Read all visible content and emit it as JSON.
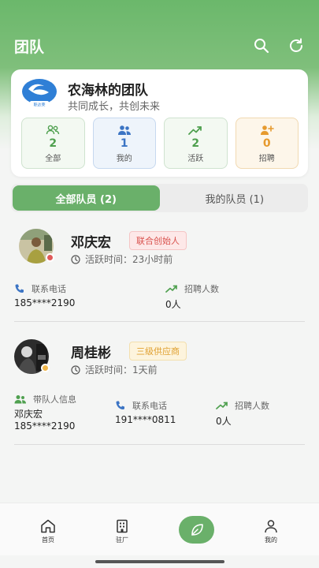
{
  "header": {
    "title": "团队"
  },
  "team": {
    "name": "农海林的团队",
    "slogan": "共同成长，共创未来",
    "stats": [
      {
        "value": "2",
        "label": "全部"
      },
      {
        "value": "1",
        "label": "我的"
      },
      {
        "value": "2",
        "label": "活跃"
      },
      {
        "value": "0",
        "label": "招聘"
      }
    ]
  },
  "tabs": [
    {
      "label": "全部队员 (2)",
      "active": true
    },
    {
      "label": "我的队员 (1)",
      "active": false
    }
  ],
  "members": [
    {
      "name": "邓庆宏",
      "badge": "联合创始人",
      "active_label": "活跃时间：",
      "active_time": "23小时前",
      "phone_label": "联系电话",
      "phone": "185****2190",
      "recruit_label": "招聘人数",
      "recruit": "0人",
      "status_color": "#e05a5a"
    },
    {
      "name": "周桂彬",
      "badge": "三级供应商",
      "active_label": "活跃时间：",
      "active_time": "1天前",
      "leader_label": "带队人信息",
      "leader_name": "邓庆宏",
      "leader_phone": "185****2190",
      "phone_label": "联系电话",
      "phone": "191****0811",
      "recruit_label": "招聘人数",
      "recruit": "0人",
      "status_color": "#f0b64a"
    }
  ],
  "nav": {
    "items": [
      {
        "label": "首页",
        "icon": "home-icon"
      },
      {
        "label": "驻厂",
        "icon": "building-icon"
      },
      {
        "label": "我的",
        "icon": "user-icon"
      }
    ],
    "center_icon": "leaf-icon"
  },
  "colors": {
    "accent": "#6ab06a",
    "blue": "#3b74c4",
    "orange": "#e69a2e"
  }
}
